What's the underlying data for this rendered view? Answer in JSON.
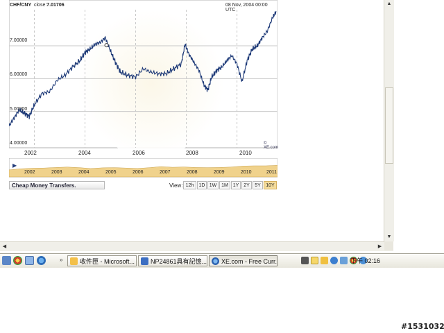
{
  "chart_header": {
    "pair": "CHF/CNY",
    "close_label": "close:",
    "close_value": "7.01706",
    "datetime": "08 Nov, 2004 00:00 UTC"
  },
  "chart_data": {
    "type": "line",
    "xlabel": "",
    "ylabel": "",
    "xlim": [
      2001.0,
      2011.6
    ],
    "ylim": [
      4.0,
      8.1
    ],
    "y_ticks": [
      "4.00000",
      "5.00000",
      "6.00000",
      "7.00000"
    ],
    "x_ticks": [
      "2002",
      "2004",
      "2006",
      "2008",
      "2010"
    ],
    "grid": true,
    "marker_point": [
      2004.85,
      7.02
    ],
    "series": [
      {
        "x": [
          2001.0,
          2001.2,
          2001.4,
          2001.6,
          2001.8,
          2002.0,
          2002.3,
          2002.6,
          2002.9,
          2003.2,
          2003.5,
          2003.8,
          2004.0,
          2004.2,
          2004.4,
          2004.6,
          2004.8,
          2005.0,
          2005.2,
          2005.4,
          2005.7,
          2006.0,
          2006.3,
          2006.6,
          2006.9,
          2007.2,
          2007.5,
          2007.8,
          2007.95,
          2008.1,
          2008.3,
          2008.5,
          2008.7,
          2008.85,
          2009.0,
          2009.2,
          2009.4,
          2009.6,
          2009.8,
          2010.0,
          2010.2,
          2010.4,
          2010.6,
          2010.8,
          2011.0,
          2011.2,
          2011.4,
          2011.55
        ],
        "y": [
          4.55,
          4.8,
          5.05,
          4.95,
          4.85,
          5.2,
          5.55,
          5.6,
          5.95,
          6.1,
          6.35,
          6.55,
          6.8,
          6.9,
          7.05,
          7.1,
          7.25,
          6.85,
          6.5,
          6.2,
          6.1,
          6.05,
          6.3,
          6.2,
          6.15,
          6.15,
          6.3,
          6.45,
          7.05,
          6.75,
          6.5,
          6.25,
          5.8,
          5.65,
          6.05,
          6.25,
          6.35,
          6.55,
          6.7,
          6.45,
          5.9,
          6.55,
          6.9,
          7.0,
          7.25,
          7.45,
          7.85,
          8.05
        ]
      }
    ]
  },
  "copyright": "© XE.com",
  "navigator": {
    "labels": [
      "2002",
      "2003",
      "2004",
      "2005",
      "2006",
      "2007",
      "2008",
      "2009",
      "2010",
      "2011"
    ],
    "values": [
      0.35,
      0.4,
      0.45,
      0.55,
      0.7,
      0.65,
      0.55,
      0.5,
      0.6,
      0.55,
      0.5,
      0.55,
      0.6,
      0.7,
      0.65,
      0.8,
      0.6,
      0.55,
      0.65,
      0.75,
      0.8,
      0.85,
      0.95,
      1.0
    ]
  },
  "transfers_label": "Cheap Money Transfers.",
  "view": {
    "label": "View:",
    "buttons": [
      "12h",
      "1D",
      "1W",
      "1M",
      "1Y",
      "2Y",
      "5Y",
      "10Y"
    ],
    "active": "10Y"
  },
  "taskbar": {
    "tasks": [
      "收件匣 - Microsoft...",
      "NP24861具有記憶...",
      "XE.com - Free Curr..."
    ],
    "clock": "下午 02:16"
  },
  "watermark": "#1531032",
  "colors": {
    "line": "#1e3a78",
    "navigator_fill": "#f0d28c",
    "grid": "#c8c8c8",
    "active_button": "#f4dc9c"
  }
}
